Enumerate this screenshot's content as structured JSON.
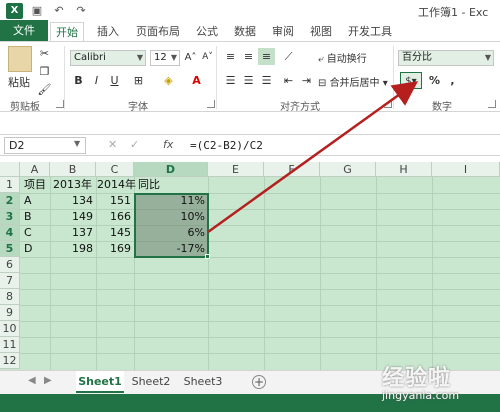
{
  "app": {
    "icon_label": "X",
    "title": "工作簿1 - Exc"
  },
  "tabs": [
    "文件",
    "开始",
    "插入",
    "页面布局",
    "公式",
    "数据",
    "审阅",
    "视图",
    "开发工具"
  ],
  "ribbon": {
    "clipboard": {
      "paste_label": "粘贴",
      "group_label": "剪贴板"
    },
    "font": {
      "font_name": "Calibri",
      "font_size": "12",
      "bold": "B",
      "italic": "I",
      "underline": "U",
      "group_label": "字体"
    },
    "alignment": {
      "group_label": "对齐方式",
      "wrap_text": "自动换行",
      "merge_center": "合并后居中"
    },
    "number": {
      "format": "百分比",
      "percent_symbol": "%",
      "comma_symbol": ",",
      "group_label": "数字"
    }
  },
  "formula_bar": {
    "name_box": "D2",
    "fx": "fx",
    "formula": "=(C2-B2)/C2"
  },
  "grid": {
    "columns": [
      "A",
      "B",
      "C",
      "D",
      "E",
      "F",
      "G",
      "H",
      "I"
    ],
    "rows": [
      "1",
      "2",
      "3",
      "4",
      "5",
      "6",
      "7",
      "8",
      "9",
      "10",
      "11",
      "12"
    ],
    "header_row": [
      "项目",
      "2013年",
      "2014年",
      "同比"
    ],
    "data": [
      [
        "A",
        "134",
        "151",
        "11%"
      ],
      [
        "B",
        "149",
        "166",
        "10%"
      ],
      [
        "C",
        "137",
        "145",
        "6%"
      ],
      [
        "D",
        "198",
        "169",
        "-17%"
      ]
    ]
  },
  "sheets": [
    "Sheet1",
    "Sheet2",
    "Sheet3"
  ],
  "add_sheet": "+",
  "colors": {
    "accent": "#217346",
    "grid_bg": "#c9e6cf",
    "arrow": "#b5201f"
  },
  "watermark": {
    "text": "经验啦",
    "url": "jingyanla.com"
  }
}
